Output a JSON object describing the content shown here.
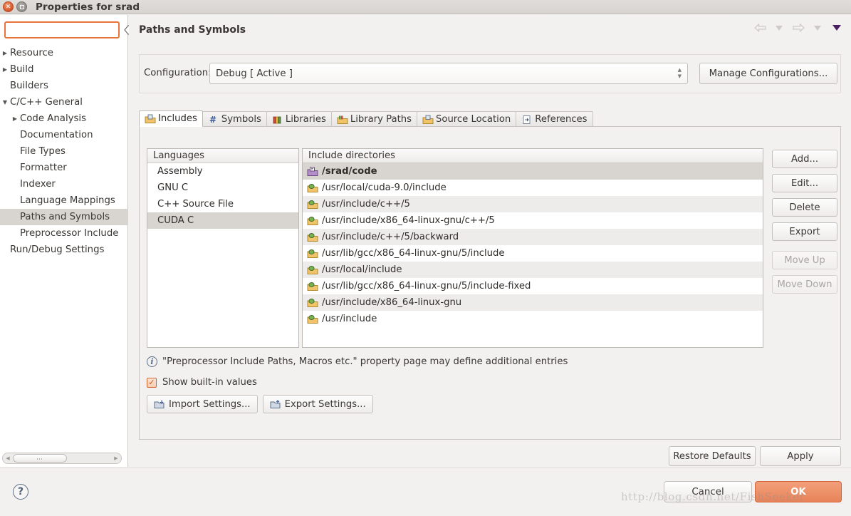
{
  "window": {
    "title": "Properties for srad",
    "close_label": "close-window",
    "maximize_label": "maximize-window"
  },
  "sidebar": {
    "search": {
      "value": "",
      "placeholder": ""
    },
    "items": [
      {
        "label": "Resource",
        "twisty": "collapsed",
        "indent": 0,
        "selected": false
      },
      {
        "label": "Build",
        "twisty": "collapsed",
        "indent": 0,
        "selected": false
      },
      {
        "label": "Builders",
        "twisty": "none",
        "indent": 0,
        "selected": false
      },
      {
        "label": "C/C++ General",
        "twisty": "expanded",
        "indent": 0,
        "selected": false
      },
      {
        "label": "Code Analysis",
        "twisty": "collapsed",
        "indent": 1,
        "selected": false
      },
      {
        "label": "Documentation",
        "twisty": "none",
        "indent": 1,
        "selected": false
      },
      {
        "label": "File Types",
        "twisty": "none",
        "indent": 1,
        "selected": false
      },
      {
        "label": "Formatter",
        "twisty": "none",
        "indent": 1,
        "selected": false
      },
      {
        "label": "Indexer",
        "twisty": "none",
        "indent": 1,
        "selected": false
      },
      {
        "label": "Language Mappings",
        "twisty": "none",
        "indent": 1,
        "selected": false
      },
      {
        "label": "Paths and Symbols",
        "twisty": "none",
        "indent": 1,
        "selected": true
      },
      {
        "label": "Preprocessor Include",
        "twisty": "none",
        "indent": 1,
        "selected": false
      },
      {
        "label": "Run/Debug Settings",
        "twisty": "none",
        "indent": 0,
        "selected": false
      }
    ]
  },
  "page": {
    "title": "Paths and Symbols",
    "nav": {
      "back_icon": "back-arrow-icon",
      "back_menu_icon": "chevron-down-icon",
      "forward_icon": "forward-arrow-icon",
      "forward_menu_icon": "chevron-down-icon",
      "view_menu_icon": "view-menu-chevron-icon"
    }
  },
  "configuration": {
    "label": "Configuration:",
    "value": "Debug  [ Active ]",
    "manage_label": "Manage Configurations..."
  },
  "tabs": [
    {
      "label": "Includes",
      "icon": "includes-icon",
      "active": true
    },
    {
      "label": "Symbols",
      "icon": "hash-icon",
      "active": false
    },
    {
      "label": "Libraries",
      "icon": "libraries-icon",
      "active": false
    },
    {
      "label": "Library Paths",
      "icon": "library-paths-icon",
      "active": false
    },
    {
      "label": "Source Location",
      "icon": "source-location-icon",
      "active": false
    },
    {
      "label": "References",
      "icon": "references-icon",
      "active": false
    }
  ],
  "languages": {
    "header": "Languages",
    "items": [
      {
        "label": "Assembly",
        "selected": false
      },
      {
        "label": "GNU C",
        "selected": false
      },
      {
        "label": "C++ Source File",
        "selected": false
      },
      {
        "label": "CUDA C",
        "selected": true
      }
    ]
  },
  "include_directories": {
    "header": "Include directories",
    "items": [
      {
        "path": "/srad/code",
        "icon": "workspace-folder-icon",
        "bold": true,
        "selected": true
      },
      {
        "path": "/usr/local/cuda-9.0/include",
        "icon": "builtin-folder-icon",
        "bold": false,
        "selected": false
      },
      {
        "path": "/usr/include/c++/5",
        "icon": "builtin-folder-icon",
        "bold": false,
        "selected": false
      },
      {
        "path": "/usr/include/x86_64-linux-gnu/c++/5",
        "icon": "builtin-folder-icon",
        "bold": false,
        "selected": false
      },
      {
        "path": "/usr/include/c++/5/backward",
        "icon": "builtin-folder-icon",
        "bold": false,
        "selected": false
      },
      {
        "path": "/usr/lib/gcc/x86_64-linux-gnu/5/include",
        "icon": "builtin-folder-icon",
        "bold": false,
        "selected": false
      },
      {
        "path": "/usr/local/include",
        "icon": "builtin-folder-icon",
        "bold": false,
        "selected": false
      },
      {
        "path": "/usr/lib/gcc/x86_64-linux-gnu/5/include-fixed",
        "icon": "builtin-folder-icon",
        "bold": false,
        "selected": false
      },
      {
        "path": "/usr/include/x86_64-linux-gnu",
        "icon": "builtin-folder-icon",
        "bold": false,
        "selected": false
      },
      {
        "path": "/usr/include",
        "icon": "builtin-folder-icon",
        "bold": false,
        "selected": false
      }
    ]
  },
  "side_buttons": [
    {
      "label": "Add...",
      "enabled": true,
      "gap": false
    },
    {
      "label": "Edit...",
      "enabled": true,
      "gap": false
    },
    {
      "label": "Delete",
      "enabled": true,
      "gap": false
    },
    {
      "label": "Export",
      "enabled": true,
      "gap": false
    },
    {
      "label": "Move Up",
      "enabled": false,
      "gap": true
    },
    {
      "label": "Move Down",
      "enabled": false,
      "gap": false
    }
  ],
  "note": {
    "icon": "info-icon",
    "text": "\"Preprocessor Include Paths, Macros etc.\" property page may define additional entries"
  },
  "show_builtin": {
    "label": "Show built-in values",
    "checked": true,
    "check_glyph": "✓"
  },
  "settings_buttons": [
    {
      "label": "Import Settings...",
      "icon": "import-icon"
    },
    {
      "label": "Export Settings...",
      "icon": "export-icon"
    }
  ],
  "page_buttons": {
    "restore_defaults": "Restore Defaults",
    "apply": "Apply"
  },
  "dialog_buttons": {
    "help_glyph": "?",
    "cancel": "Cancel",
    "ok": "OK"
  },
  "watermark": "http://blog.csdn.net/FishSeeker",
  "colors": {
    "accent_orange": "#e8743b",
    "ok_button": "#e8835a",
    "selection_gray": "#d8d5d1",
    "window_bg": "#f2f1f0"
  }
}
